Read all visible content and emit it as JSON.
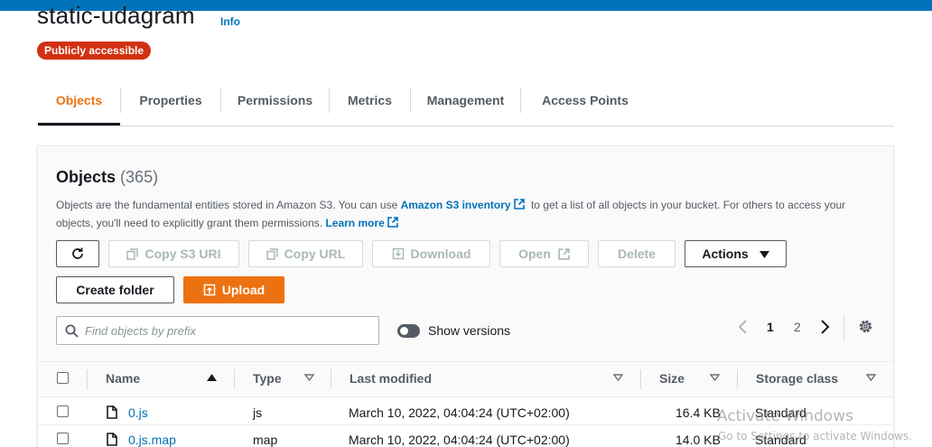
{
  "bucket": {
    "name": "static-udagram",
    "info_label": "Info",
    "access_badge": "Publicly accessible"
  },
  "tabs": [
    {
      "label": "Objects",
      "active": true
    },
    {
      "label": "Properties",
      "active": false
    },
    {
      "label": "Permissions",
      "active": false
    },
    {
      "label": "Metrics",
      "active": false
    },
    {
      "label": "Management",
      "active": false
    },
    {
      "label": "Access Points",
      "active": false
    }
  ],
  "objects_panel": {
    "title": "Objects",
    "count": "(365)",
    "description_part1": "Objects are the fundamental entities stored in Amazon S3. You can use ",
    "inventory_link": "Amazon S3 inventory",
    "description_part2": " to get a list of all objects in your bucket. For others to access your objects, you'll need to explicitly grant them permissions. ",
    "learn_more": "Learn more"
  },
  "toolbar": {
    "refresh_icon": "refresh-icon",
    "copy_s3_uri": "Copy S3 URI",
    "copy_url": "Copy URL",
    "download": "Download",
    "open": "Open",
    "delete": "Delete",
    "actions": "Actions",
    "create_folder": "Create folder",
    "upload": "Upload"
  },
  "search": {
    "placeholder": "Find objects by prefix",
    "value": ""
  },
  "show_versions": {
    "label": "Show versions",
    "enabled": false
  },
  "pagination": {
    "pages": [
      "1",
      "2"
    ],
    "current": "1"
  },
  "table": {
    "columns": {
      "name": "Name",
      "type": "Type",
      "last_modified": "Last modified",
      "size": "Size",
      "storage_class": "Storage class"
    },
    "rows": [
      {
        "name": "0.js",
        "type": "js",
        "last_modified": "March 10, 2022, 04:04:24 (UTC+02:00)",
        "size": "16.4 KB",
        "storage_class": "Standard"
      },
      {
        "name": "0.js.map",
        "type": "map",
        "last_modified": "March 10, 2022, 04:04:24 (UTC+02:00)",
        "size": "14.0 KB",
        "storage_class": "Standard"
      }
    ]
  },
  "watermark": {
    "line1": "Activate Windows",
    "line2": "Go to Settings to activate Windows."
  },
  "colors": {
    "accent": "#ec7211",
    "link": "#0073bb",
    "badge": "#d13212",
    "top_bar": "#0073bb"
  }
}
